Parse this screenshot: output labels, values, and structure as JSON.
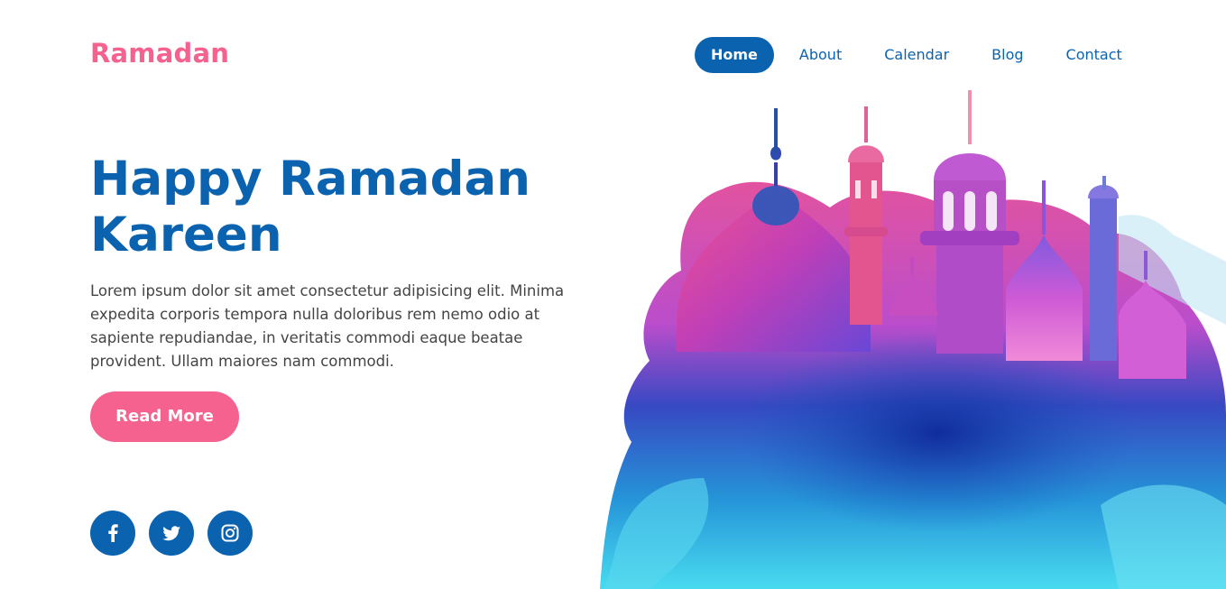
{
  "brand": {
    "name": "Ramadan"
  },
  "nav": {
    "items": [
      {
        "label": "Home",
        "active": true
      },
      {
        "label": "About"
      },
      {
        "label": "Calendar"
      },
      {
        "label": "Blog"
      },
      {
        "label": "Contact"
      }
    ]
  },
  "hero": {
    "title_line1": "Happy Ramadan",
    "title_line2": "Kareen",
    "description": "Lorem ipsum dolor sit amet consectetur adipisicing elit. Minima expedita corporis tempora nulla doloribus rem nemo odio at sapiente repudiandae, in veritatis commodi eaque beatae provident. Ullam maiores nam commodi.",
    "cta_label": "Read More",
    "illustration": "watercolor-mosque-illustration"
  },
  "social": {
    "icons": [
      "facebook-icon",
      "twitter-icon",
      "instagram-icon"
    ]
  },
  "colors": {
    "brand_pink": "#f5628f",
    "primary_blue": "#0b63b0",
    "text_gray": "#444444"
  }
}
